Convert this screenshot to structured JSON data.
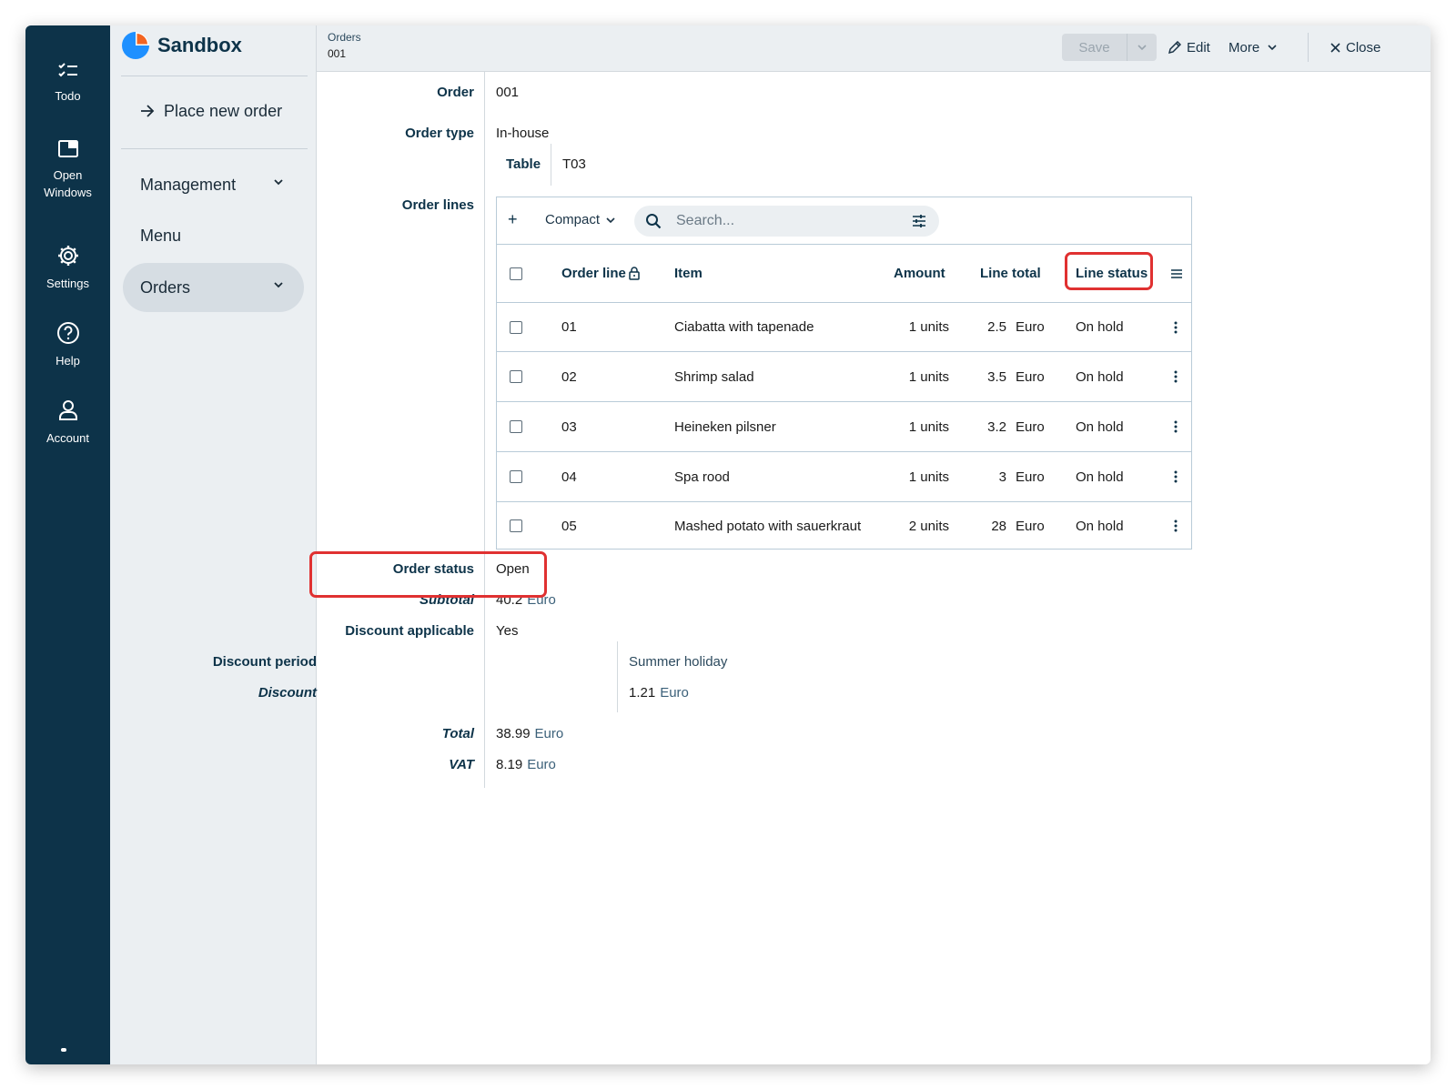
{
  "rail": {
    "items": [
      {
        "label": "Todo"
      },
      {
        "label_line1": "Open",
        "label_line2": "Windows"
      },
      {
        "label": "Settings"
      },
      {
        "label": "Help"
      },
      {
        "label": "Account"
      }
    ]
  },
  "nav": {
    "brand": "Sandbox",
    "place_order": "Place new order",
    "items": [
      {
        "label": "Management"
      },
      {
        "label": "Menu"
      },
      {
        "label": "Orders"
      }
    ]
  },
  "toolbar": {
    "crumb_parent": "Orders",
    "crumb_current": "001",
    "save": "Save",
    "edit": "Edit",
    "more": "More",
    "close": "Close"
  },
  "form": {
    "order_label": "Order",
    "order_value": "001",
    "order_type_label": "Order type",
    "order_type_value": "In-house",
    "table_label": "Table",
    "table_value": "T03",
    "order_lines_label": "Order lines",
    "order_status_label": "Order status",
    "order_status_value": "Open",
    "subtotal_label": "Subtotal",
    "subtotal_value": "40.2",
    "subtotal_unit": "Euro",
    "discount_applicable_label": "Discount applicable",
    "discount_applicable_value": "Yes",
    "discount_period_label": "Discount period",
    "discount_period_value": "Summer holiday",
    "discount_label": "Discount",
    "discount_value": "1.21",
    "discount_unit": "Euro",
    "total_label": "Total",
    "total_value": "38.99",
    "total_unit": "Euro",
    "vat_label": "VAT",
    "vat_value": "8.19",
    "vat_unit": "Euro"
  },
  "grid": {
    "compact": "Compact",
    "search_placeholder": "Search...",
    "columns": {
      "order_line": "Order line",
      "item": "Item",
      "amount": "Amount",
      "line_total": "Line total",
      "line_status": "Line status"
    },
    "rows": [
      {
        "line": "01",
        "item": "Ciabatta with tapenade",
        "amount": "1 units",
        "total": "2.5",
        "unit": "Euro",
        "status": "On hold"
      },
      {
        "line": "02",
        "item": "Shrimp salad",
        "amount": "1 units",
        "total": "3.5",
        "unit": "Euro",
        "status": "On hold"
      },
      {
        "line": "03",
        "item": "Heineken pilsner",
        "amount": "1 units",
        "total": "3.2",
        "unit": "Euro",
        "status": "On hold"
      },
      {
        "line": "04",
        "item": "Spa rood",
        "amount": "1 units",
        "total": "3",
        "unit": "Euro",
        "status": "On hold"
      },
      {
        "line": "05",
        "item": "Mashed potato with sauerkraut",
        "amount": "2 units",
        "total": "28",
        "unit": "Euro",
        "status": "On hold"
      }
    ]
  },
  "colors": {
    "rail_bg": "#0d3349",
    "nav_bg": "#ebeff2",
    "label": "#0d3349",
    "highlight": "#e03131",
    "brand_blue": "#1e90ff",
    "brand_orange": "#f26522"
  }
}
